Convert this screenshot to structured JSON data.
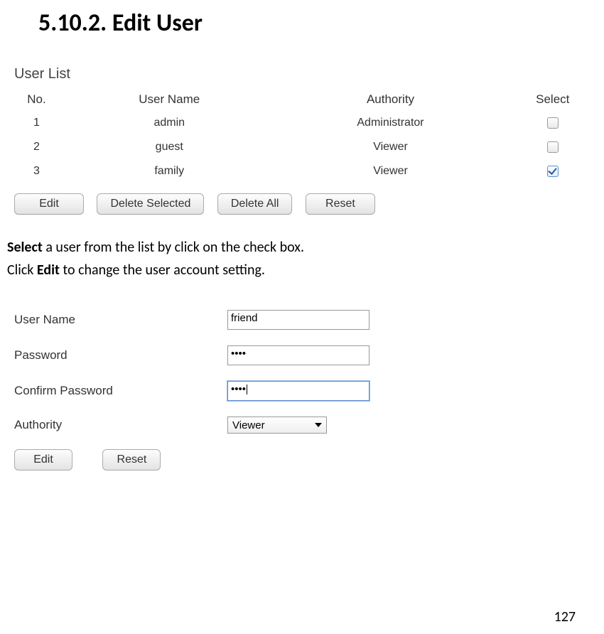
{
  "section_heading": "5.10.2. Edit User",
  "user_list": {
    "title": "User List",
    "columns": {
      "no": "No.",
      "username": "User Name",
      "authority": "Authority",
      "select": "Select"
    },
    "rows": [
      {
        "no": "1",
        "username": "admin",
        "authority": "Administrator",
        "checked": false
      },
      {
        "no": "2",
        "username": "guest",
        "authority": "Viewer",
        "checked": false
      },
      {
        "no": "3",
        "username": "family",
        "authority": "Viewer",
        "checked": true
      }
    ],
    "buttons": {
      "edit": "Edit",
      "delete_selected": "Delete Selected",
      "delete_all": "Delete All",
      "reset": "Reset"
    }
  },
  "instructions": {
    "line1_prefix": "Select",
    "line1_rest": " a user from the list by click on the check box.",
    "line2_prefix": "Click ",
    "line2_bold": "Edit",
    "line2_rest": " to change the user account setting."
  },
  "edit_form": {
    "labels": {
      "username": "User Name",
      "password": "Password",
      "confirm": "Confirm Password",
      "authority": "Authority"
    },
    "values": {
      "username": "friend",
      "password": "••••",
      "confirm": "••••",
      "authority_selected": "Viewer"
    },
    "buttons": {
      "edit": "Edit",
      "reset": "Reset"
    }
  },
  "page_number": "127"
}
